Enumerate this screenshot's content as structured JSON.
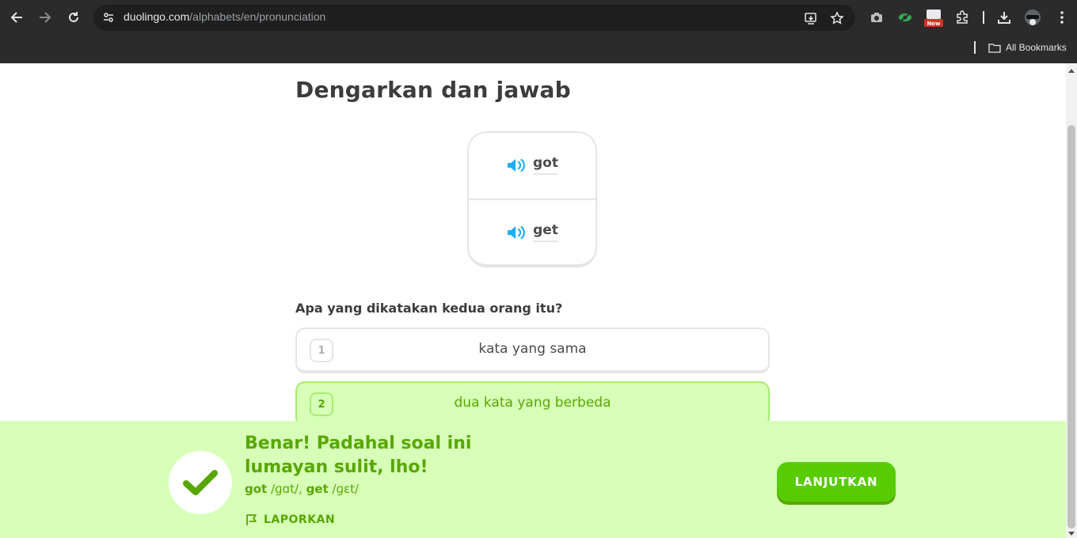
{
  "browser": {
    "url_host": "duolingo.com",
    "url_path": "/alphabets/en/pronunciation",
    "bookmarks_label": "All Bookmarks",
    "extension_badge": "New"
  },
  "lesson": {
    "title": "Dengarkan dan jawab",
    "words": [
      "got",
      "get"
    ],
    "question": "Apa yang dikatakan kedua orang itu?",
    "options": [
      {
        "number": "1",
        "text": "kata yang sama",
        "selected": false
      },
      {
        "number": "2",
        "text": "dua kata yang berbeda",
        "selected": true
      }
    ]
  },
  "feedback": {
    "title": "Benar! Padahal soal ini lumayan sulit, lho!",
    "word1": "got",
    "ipa1": " /ɡɑt/, ",
    "word2": "get",
    "ipa2": " /ɡɛt/",
    "report_label": "LAPORKAN",
    "continue_label": "LANJUTKAN"
  },
  "colors": {
    "success_bg": "#d7ffb8",
    "success_text": "#58a700",
    "primary_button": "#58cc02",
    "speaker_blue": "#1cb0f6"
  }
}
